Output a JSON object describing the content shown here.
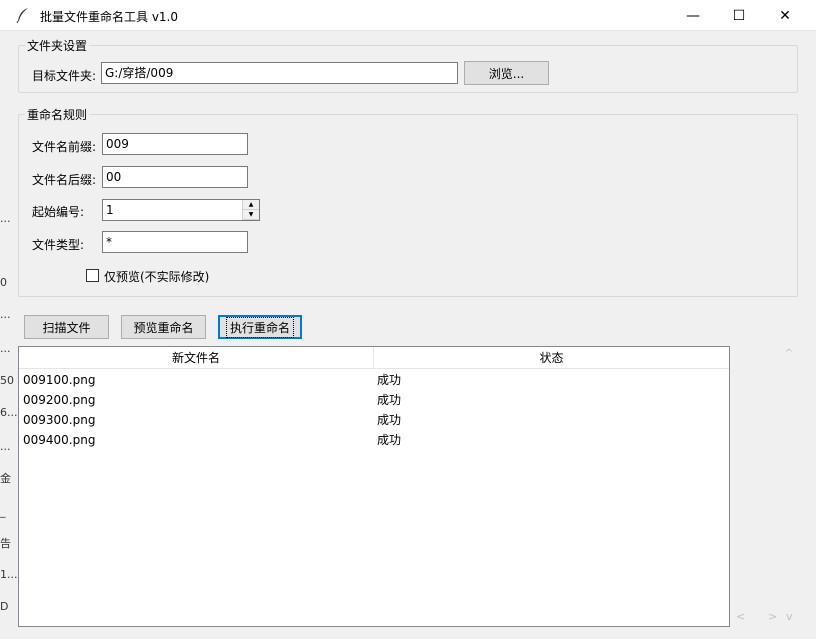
{
  "window": {
    "title": "批量文件重命名工具 v1.0",
    "minimize_glyph": "—",
    "maximize_glyph": "☐",
    "close_glyph": "✕"
  },
  "folder_group": {
    "legend": "文件夹设置",
    "target_label": "目标文件夹:",
    "target_value": "G:/穿搭/009",
    "browse_label": "浏览..."
  },
  "rules_group": {
    "legend": "重命名规则",
    "prefix_label": "文件名前缀:",
    "prefix_value": "009",
    "suffix_label": "文件名后缀:",
    "suffix_value": "00",
    "start_label": "起始编号:",
    "start_value": "1",
    "type_label": "文件类型:",
    "type_value": "*",
    "preview_only_label": "仅预览(不实际修改)",
    "preview_only_checked": false
  },
  "actions": {
    "scan_label": "扫描文件",
    "preview_label": "预览重命名",
    "execute_label": "执行重命名"
  },
  "table": {
    "columns": [
      "新文件名",
      "状态"
    ],
    "rows": [
      {
        "name": "009100.png",
        "status": "成功"
      },
      {
        "name": "009200.png",
        "status": "成功"
      },
      {
        "name": "009300.png",
        "status": "成功"
      },
      {
        "name": "009400.png",
        "status": "成功"
      }
    ]
  },
  "scrollbar": {
    "up_glyph": "^",
    "left_glyph": "<",
    "right_glyph": ">",
    "down_glyph": "v"
  },
  "background_fragments": [
    "...",
    "0",
    "...",
    "...",
    "50",
    "6...",
    "...",
    "金",
    "_",
    "告",
    "1...",
    "D"
  ]
}
